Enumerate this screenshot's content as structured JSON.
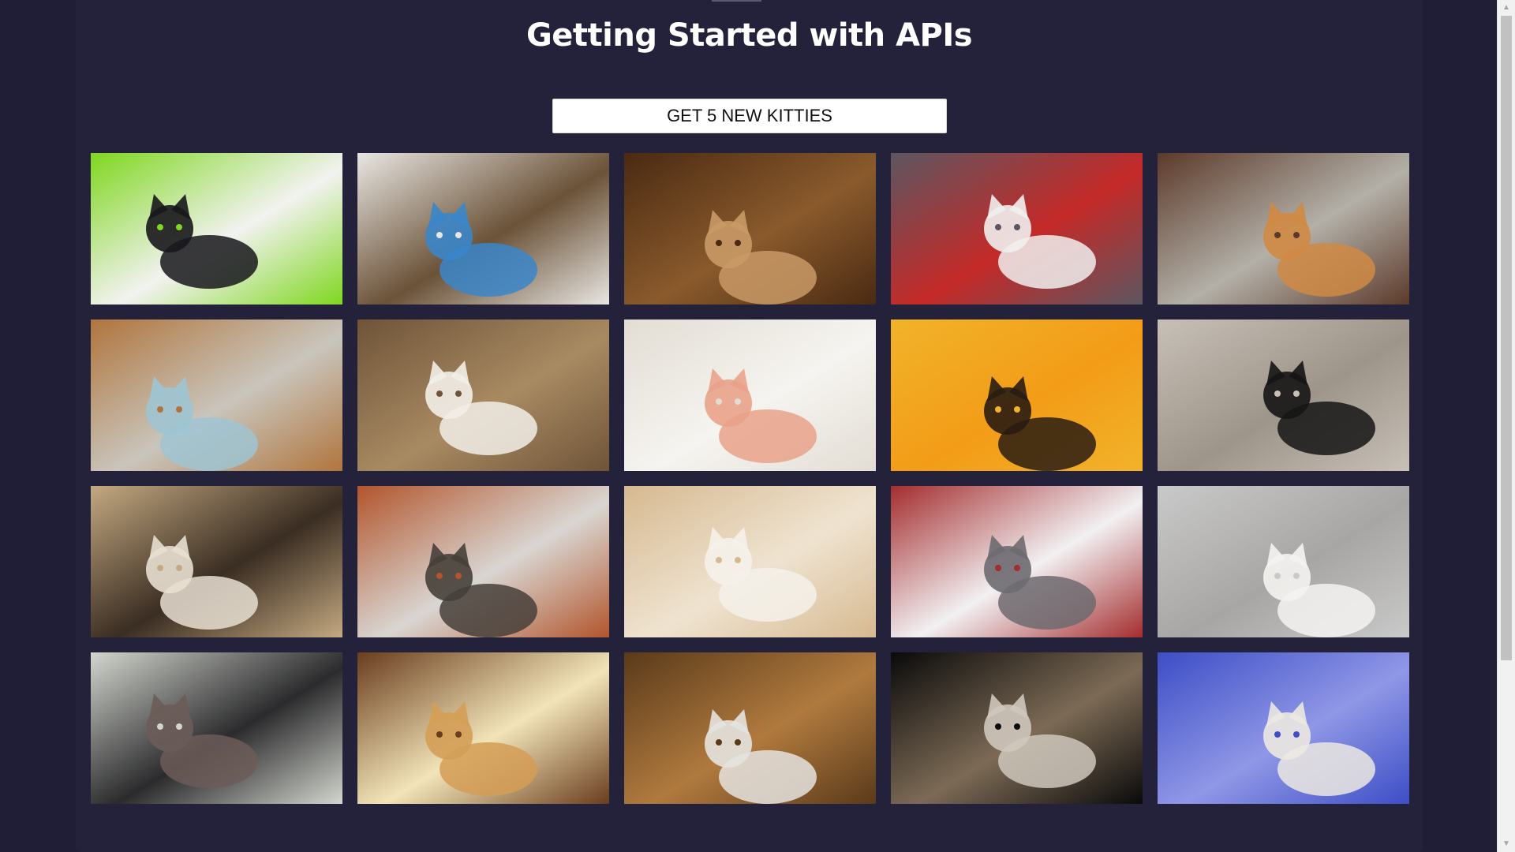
{
  "header": {
    "title": "Getting Started with APIs"
  },
  "controls": {
    "fetch_label": "GET 5 NEW KITTIES"
  },
  "gallery": {
    "rows": 4,
    "columns": 5,
    "images": [
      {
        "name": "black-white-cat-green-background",
        "palette": [
          "#7fd71f",
          "#f2f2f0",
          "#18171c"
        ]
      },
      {
        "name": "tabby-cat-with-blue-toy",
        "palette": [
          "#e8e6e2",
          "#6b5238",
          "#3a86c9"
        ]
      },
      {
        "name": "cat-peeking-under-table",
        "palette": [
          "#4a2a12",
          "#8a5a2c",
          "#c99a66"
        ]
      },
      {
        "name": "black-white-cat-in-red-basket",
        "palette": [
          "#5d5660",
          "#c42a28",
          "#f1efee"
        ]
      },
      {
        "name": "orange-cat-on-pavement",
        "palette": [
          "#5c3a2a",
          "#b3b0a8",
          "#d08a44"
        ]
      },
      {
        "name": "kittens-in-woven-basket",
        "palette": [
          "#b0753d",
          "#c9c5bc",
          "#9fc4d2"
        ]
      },
      {
        "name": "gray-cat-lying-close-up",
        "palette": [
          "#6f5438",
          "#a88a62",
          "#f2eee8"
        ]
      },
      {
        "name": "white-orange-kitten-biting-finger",
        "palette": [
          "#e2ddd4",
          "#f6f4f0",
          "#e9a28a"
        ]
      },
      {
        "name": "orange-striped-costume",
        "palette": [
          "#f1b32a",
          "#f39c18",
          "#2a1c12"
        ]
      },
      {
        "name": "black-kitten-with-shredded-paper",
        "palette": [
          "#c7c0b6",
          "#9e958a",
          "#151515"
        ]
      },
      {
        "name": "kittens-in-cardboard-box",
        "palette": [
          "#c4a981",
          "#3a2d22",
          "#e8dfd2"
        ]
      },
      {
        "name": "tabby-kitten-blue-eyes",
        "palette": [
          "#b2552c",
          "#d9d6d2",
          "#46403a"
        ]
      },
      {
        "name": "white-cat-on-wall-shelf",
        "palette": [
          "#d6b990",
          "#efe3d0",
          "#f5f1ea"
        ]
      },
      {
        "name": "gray-cat-in-white-bin",
        "palette": [
          "#a42d2e",
          "#f2f0f2",
          "#6d6a70"
        ]
      },
      {
        "name": "gray-cat-in-pet-bed",
        "palette": [
          "#c9c9c9",
          "#a8a6a4",
          "#f4f3f1"
        ]
      },
      {
        "name": "cat-in-car-back-seat",
        "palette": [
          "#d3d6ce",
          "#2b2b2d",
          "#6c5c58"
        ]
      },
      {
        "name": "cream-cat-rolling-on-rug",
        "palette": [
          "#6a3d1e",
          "#f2e4b8",
          "#d49e55"
        ]
      },
      {
        "name": "black-white-kitten-in-cupboard",
        "palette": [
          "#5a3a1a",
          "#b07a3e",
          "#e5e3df"
        ]
      },
      {
        "name": "tabby-kitten-black-background",
        "palette": [
          "#0a0a0a",
          "#7c6a55",
          "#cfc7bc"
        ]
      },
      {
        "name": "siamese-kitten-blue-flowers",
        "palette": [
          "#3d4ec6",
          "#8f97e6",
          "#ece8e1"
        ]
      }
    ]
  }
}
